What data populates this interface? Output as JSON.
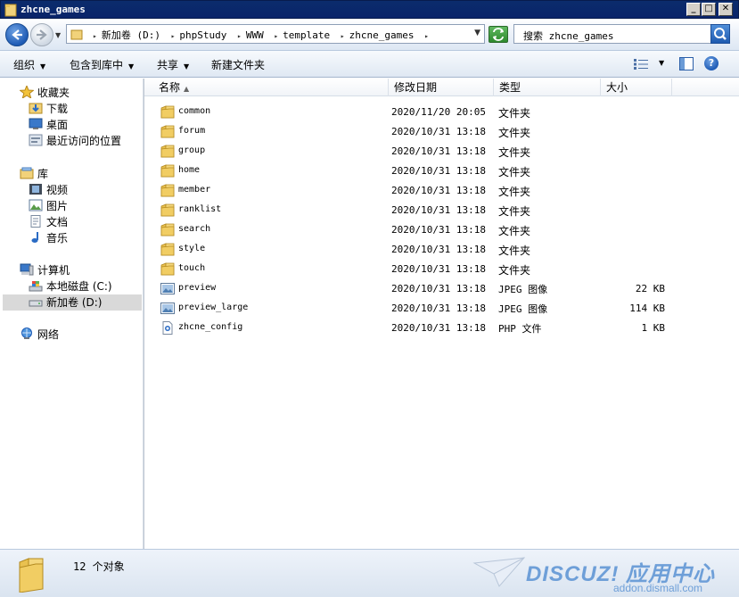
{
  "window": {
    "title": "zhcne_games"
  },
  "address": {
    "crumbs": [
      "新加卷 (D:)",
      "phpStudy",
      "WWW",
      "template",
      "zhcne_games"
    ]
  },
  "search": {
    "text": "搜索 zhcne_games"
  },
  "toolbar": {
    "organize": "组织",
    "include_in_library": "包含到库中",
    "share": "共享",
    "new_folder": "新建文件夹"
  },
  "nav": {
    "favorites": "收藏夹",
    "downloads": "下载",
    "desktop": "桌面",
    "recent": "最近访问的位置",
    "libraries": "库",
    "videos": "视频",
    "pictures": "图片",
    "documents": "文档",
    "music": "音乐",
    "computer": "计算机",
    "local_disk": "本地磁盘 (C:)",
    "new_volume": "新加卷 (D:)",
    "network": "网络"
  },
  "columns": {
    "name": "名称",
    "date": "修改日期",
    "type": "类型",
    "size": "大小"
  },
  "files": [
    {
      "name": "common",
      "date": "2020/11/20 20:05",
      "type": "文件夹",
      "size": "",
      "kind": "folder"
    },
    {
      "name": "forum",
      "date": "2020/10/31 13:18",
      "type": "文件夹",
      "size": "",
      "kind": "folder"
    },
    {
      "name": "group",
      "date": "2020/10/31 13:18",
      "type": "文件夹",
      "size": "",
      "kind": "folder"
    },
    {
      "name": "home",
      "date": "2020/10/31 13:18",
      "type": "文件夹",
      "size": "",
      "kind": "folder"
    },
    {
      "name": "member",
      "date": "2020/10/31 13:18",
      "type": "文件夹",
      "size": "",
      "kind": "folder"
    },
    {
      "name": "ranklist",
      "date": "2020/10/31 13:18",
      "type": "文件夹",
      "size": "",
      "kind": "folder"
    },
    {
      "name": "search",
      "date": "2020/10/31 13:18",
      "type": "文件夹",
      "size": "",
      "kind": "folder"
    },
    {
      "name": "style",
      "date": "2020/10/31 13:18",
      "type": "文件夹",
      "size": "",
      "kind": "folder"
    },
    {
      "name": "touch",
      "date": "2020/10/31 13:18",
      "type": "文件夹",
      "size": "",
      "kind": "folder"
    },
    {
      "name": "preview",
      "date": "2020/10/31 13:18",
      "type": "JPEG 图像",
      "size": "22 KB",
      "kind": "image"
    },
    {
      "name": "preview_large",
      "date": "2020/10/31 13:18",
      "type": "JPEG 图像",
      "size": "114 KB",
      "kind": "image"
    },
    {
      "name": "zhcne_config",
      "date": "2020/10/31 13:18",
      "type": "PHP 文件",
      "size": "1 KB",
      "kind": "php"
    }
  ],
  "status": {
    "count": "12 个对象"
  },
  "watermark": {
    "brand": "DISCUZ! 应用中心",
    "url": "addon.dismall.com"
  },
  "colors": {
    "title_bar": "#0a246a",
    "selection": "#d9d9d9",
    "folder": "#e8c25a",
    "watermark": "#6e9fd8"
  }
}
